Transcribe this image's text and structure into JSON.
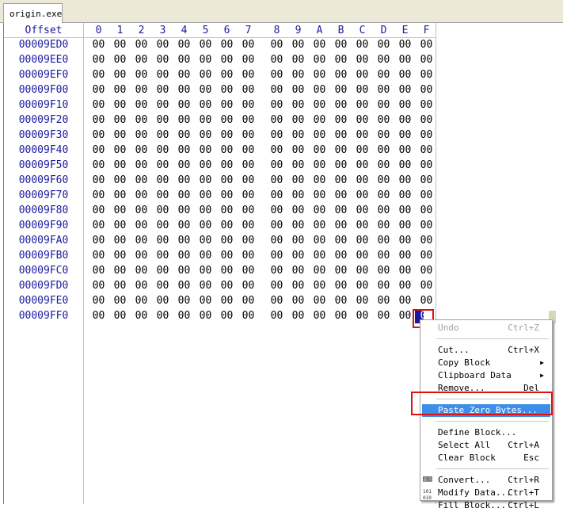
{
  "tab": {
    "label": "origin.exe"
  },
  "header": {
    "offset_label": "Offset",
    "columns": [
      "0",
      "1",
      "2",
      "3",
      "4",
      "5",
      "6",
      "7",
      "8",
      "9",
      "A",
      "B",
      "C",
      "D",
      "E",
      "F"
    ]
  },
  "rows": [
    {
      "offset": "00009ED0"
    },
    {
      "offset": "00009EE0"
    },
    {
      "offset": "00009EF0"
    },
    {
      "offset": "00009F00"
    },
    {
      "offset": "00009F10"
    },
    {
      "offset": "00009F20"
    },
    {
      "offset": "00009F30"
    },
    {
      "offset": "00009F40"
    },
    {
      "offset": "00009F50"
    },
    {
      "offset": "00009F60"
    },
    {
      "offset": "00009F70"
    },
    {
      "offset": "00009F80"
    },
    {
      "offset": "00009F90"
    },
    {
      "offset": "00009FA0"
    },
    {
      "offset": "00009FB0"
    },
    {
      "offset": "00009FC0"
    },
    {
      "offset": "00009FD0"
    },
    {
      "offset": "00009FE0"
    },
    {
      "offset": "00009FF0"
    }
  ],
  "byte_value": "00",
  "menu": {
    "items": [
      {
        "label": "Undo",
        "shortcut": "Ctrl+Z",
        "disabled": true
      },
      {
        "sep": true
      },
      {
        "label": "Cut...",
        "shortcut": "Ctrl+X"
      },
      {
        "label": "Copy Block",
        "submenu": true
      },
      {
        "label": "Clipboard Data",
        "submenu": true
      },
      {
        "label": "Remove...",
        "shortcut": "Del"
      },
      {
        "sep": true
      },
      {
        "label": "Paste Zero Bytes...",
        "highlighted": true
      },
      {
        "sep": true
      },
      {
        "label": "Define Block..."
      },
      {
        "label": "Select All",
        "shortcut": "Ctrl+A"
      },
      {
        "label": "Clear Block",
        "shortcut": "Esc"
      },
      {
        "sep": true
      },
      {
        "label": "Convert...",
        "shortcut": "Ctrl+R",
        "icon": "convert-icon"
      },
      {
        "label": "Modify Data...",
        "shortcut": "Ctrl+T",
        "icon": "binary-icon"
      },
      {
        "label": "Fill Block...",
        "shortcut": "Ctrl+L"
      }
    ]
  }
}
